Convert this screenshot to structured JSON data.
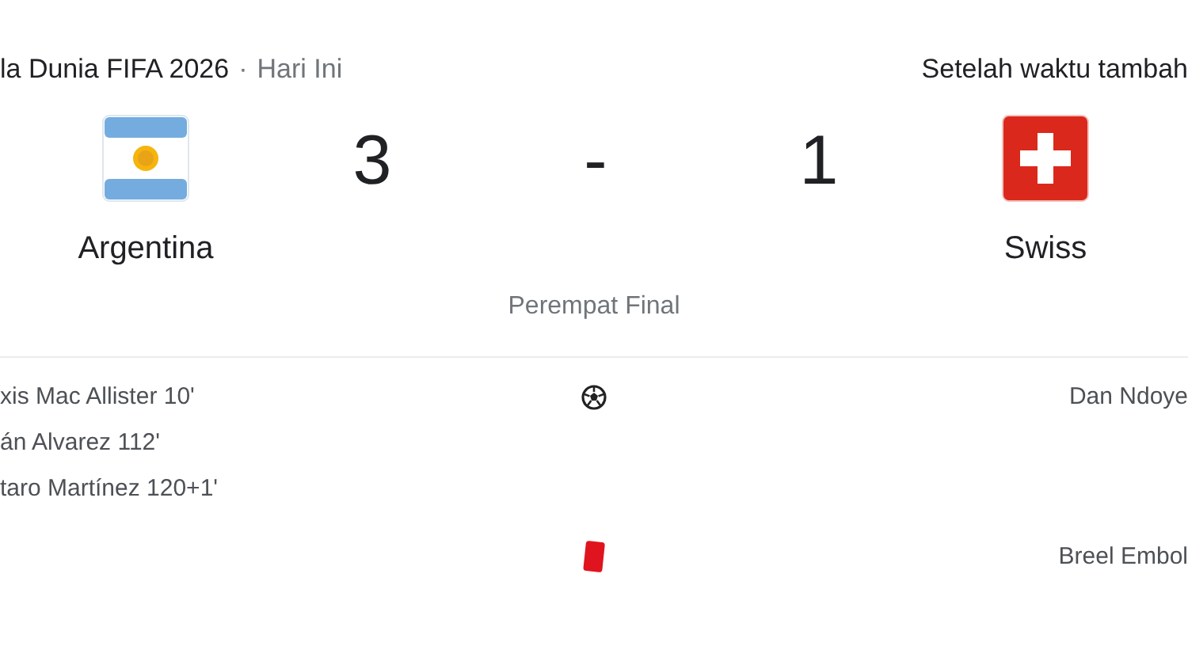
{
  "header": {
    "competition": "la Dunia FIFA 2026",
    "separator": "·",
    "date": "Hari Ini",
    "status": "Setelah waktu tambah"
  },
  "home": {
    "name": "Argentina",
    "score": "3",
    "kind": "argentina"
  },
  "score_separator": "-",
  "away": {
    "name": "Swiss",
    "score": "1",
    "kind": "switzerland"
  },
  "stage": "Perempat Final",
  "events": [
    {
      "kind": "goal",
      "home": [
        "xis Mac Allister 10'",
        "án Alvarez 112'",
        "taro Martínez 120+1'"
      ],
      "away": [
        "Dan Ndoye"
      ]
    },
    {
      "kind": "red_card",
      "away": [
        "Breel Embol"
      ]
    }
  ]
}
